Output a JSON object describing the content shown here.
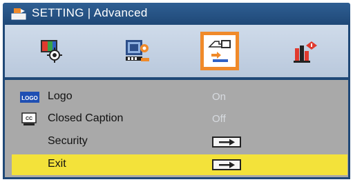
{
  "title": "SETTING | Advanced",
  "tabs": [
    {
      "icon": "image-settings-icon",
      "selected": false
    },
    {
      "icon": "display-settings-icon",
      "selected": false
    },
    {
      "icon": "setting-hand-icon",
      "selected": true
    },
    {
      "icon": "options-chart-icon",
      "selected": false
    }
  ],
  "menu": {
    "items": [
      {
        "label": "Logo",
        "value": "On",
        "icon": "logo-icon",
        "icon_text": "LOGO"
      },
      {
        "label": "Closed Caption",
        "value": "Off",
        "icon": "closed-caption-icon",
        "icon_text": "CC"
      },
      {
        "label": "Security",
        "value": null,
        "icon": null
      },
      {
        "label": "Exit",
        "value": null,
        "icon": null,
        "selected": true
      }
    ]
  },
  "colors": {
    "title_bar": "#1f4877",
    "highlight": "#f3e23a",
    "selected_border": "#f08a2a",
    "menu_bg": "#a9a9a9"
  }
}
